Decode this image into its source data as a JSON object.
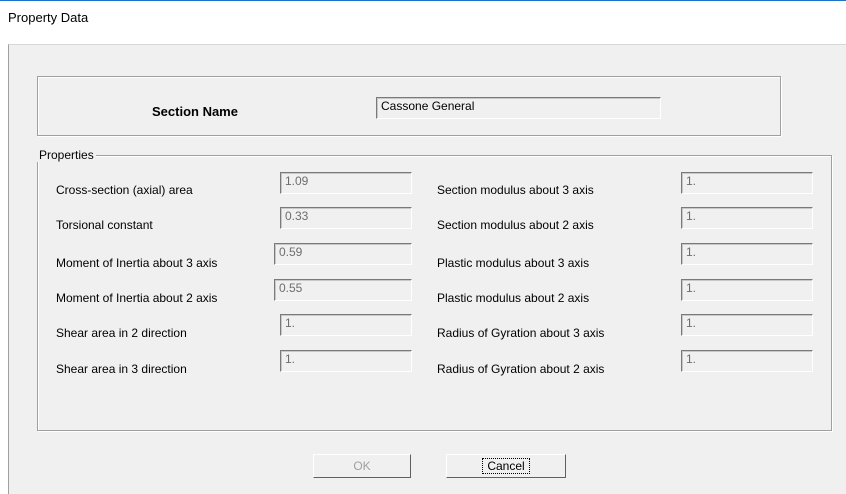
{
  "window": {
    "title": "Property Data"
  },
  "section": {
    "label": "Section Name",
    "value": "Cassone General"
  },
  "properties": {
    "group_label": "Properties",
    "left": [
      {
        "label": "Cross-section (axial) area",
        "value": "1.09"
      },
      {
        "label": "Torsional constant",
        "value": "0.33"
      },
      {
        "label": "Moment of Inertia about 3 axis",
        "value": "0.59"
      },
      {
        "label": "Moment of Inertia about 2 axis",
        "value": "0.55"
      },
      {
        "label": "Shear area in 2 direction",
        "value": "1."
      },
      {
        "label": "Shear area in 3 direction",
        "value": "1."
      }
    ],
    "right": [
      {
        "label": "Section modulus about 3 axis",
        "value": "1."
      },
      {
        "label": "Section modulus about 2 axis",
        "value": "1."
      },
      {
        "label": "Plastic modulus about 3 axis",
        "value": "1."
      },
      {
        "label": "Plastic modulus about 2 axis",
        "value": "1."
      },
      {
        "label": "Radius of Gyration about 3 axis",
        "value": "1."
      },
      {
        "label": "Radius of Gyration about 2 axis",
        "value": "1."
      }
    ]
  },
  "buttons": {
    "ok": "OK",
    "cancel": "Cancel"
  },
  "colors": {
    "face": "#f0f0f0",
    "accent": "#1a73c8",
    "disabled_text": "#a0a0a0"
  }
}
